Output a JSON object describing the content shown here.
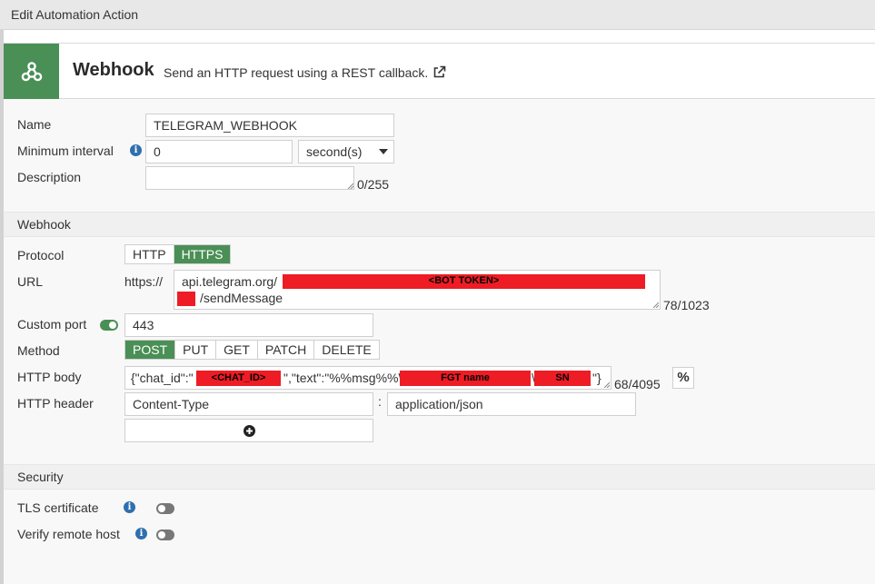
{
  "window": {
    "title": "Edit Automation Action"
  },
  "header": {
    "icon": "webhook-icon",
    "title": "Webhook",
    "description": "Send an HTTP request using a REST callback.",
    "external_icon": "external-link-icon",
    "accent_color": "#4a8f55"
  },
  "general": {
    "name_label": "Name",
    "name_value": "TELEGRAM_WEBHOOK",
    "interval_label": "Minimum interval",
    "interval_value": "0",
    "interval_unit": "second(s)",
    "description_label": "Description",
    "description_value": "",
    "description_counter": "0/255"
  },
  "webhook": {
    "section_title": "Webhook",
    "protocol_label": "Protocol",
    "protocol_options": [
      "HTTP",
      "HTTPS"
    ],
    "protocol_selected": "HTTPS",
    "url_label": "URL",
    "url_prefix": "https://",
    "url_line1": "api.telegram.org/",
    "url_redact_label": "<BOT TOKEN>",
    "url_line2": "/sendMessage",
    "url_counter": "78/1023",
    "port_label": "Custom port",
    "port_toggle": "on",
    "port_value": "443",
    "method_label": "Method",
    "methods": [
      "POST",
      "PUT",
      "GET",
      "PATCH",
      "DELETE"
    ],
    "method_selected": "POST",
    "body_label": "HTTP body",
    "body_part1": "{\"chat_id\":\"",
    "body_redact_chat": "<CHAT_ID>",
    "body_part2": "\",\"text\":\"%%msg%%\\",
    "body_redact_fgt": "FGT name",
    "body_part3": "\\",
    "body_redact_sn": "SN",
    "body_part4": "\"}",
    "body_counter": "68/4095",
    "percent_button": "%",
    "header_label": "HTTP header",
    "header_key": "Content-Type",
    "header_sep": ":",
    "header_value": "application/json",
    "add_icon": "plus-circle-icon"
  },
  "security": {
    "section_title": "Security",
    "tls_label": "TLS certificate",
    "tls_toggle": "off",
    "verify_label": "Verify remote host",
    "verify_toggle": "off"
  },
  "colors": {
    "redaction": "#ee1c24",
    "info": "#2f6fad"
  }
}
